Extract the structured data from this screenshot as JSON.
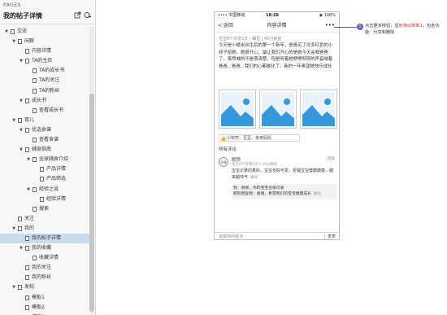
{
  "panel": {
    "label": "PAGES",
    "title": "我的帖子详情",
    "icons": [
      "export-icon",
      "add-page-icon"
    ]
  },
  "tree": [
    {
      "label": "交流",
      "depth": 0,
      "expanded": true
    },
    {
      "label": "闲聊",
      "depth": 1,
      "expanded": true
    },
    {
      "label": "内容详情",
      "depth": 2
    },
    {
      "label": "TA的主页",
      "depth": 2,
      "expanded": true
    },
    {
      "label": "TA的成长书",
      "depth": 3
    },
    {
      "label": "TA的关注",
      "depth": 3
    },
    {
      "label": "TA的粉丝",
      "depth": 3
    },
    {
      "label": "成长书",
      "depth": 2,
      "expanded": true
    },
    {
      "label": "查看成长书",
      "depth": 3
    },
    {
      "label": "育儿",
      "depth": 1,
      "expanded": true
    },
    {
      "label": "优选食谱",
      "depth": 2,
      "expanded": true
    },
    {
      "label": "查看食谱",
      "depth": 3
    },
    {
      "label": "辅食指南",
      "depth": 2,
      "expanded": true
    },
    {
      "label": "全球辅食介绍",
      "depth": 3,
      "expanded": true
    },
    {
      "label": "产品详情",
      "depth": 4
    },
    {
      "label": "产品筛选",
      "depth": 4
    },
    {
      "label": "经验之谈",
      "depth": 3,
      "expanded": true
    },
    {
      "label": "经验详情",
      "depth": 4
    },
    {
      "label": "搜索",
      "depth": 3
    },
    {
      "label": "关注",
      "depth": 1
    },
    {
      "label": "我的",
      "depth": 1,
      "expanded": true
    },
    {
      "label": "我的帖子详情",
      "depth": 2,
      "selected": true
    },
    {
      "label": "我的收藏",
      "depth": 2,
      "expanded": true
    },
    {
      "label": "收藏详情",
      "depth": 3
    },
    {
      "label": "我的关注",
      "depth": 2
    },
    {
      "label": "我的粉丝",
      "depth": 2
    },
    {
      "label": "发帖",
      "depth": 1,
      "expanded": true
    },
    {
      "label": "模板1",
      "depth": 2
    },
    {
      "label": "模板2",
      "depth": 2
    },
    {
      "label": "模板3",
      "depth": 2
    }
  ],
  "phone": {
    "status": {
      "carrier": "•••• 中国移动 ",
      "time": "18:28",
      "right": "◉ 100%"
    },
    "nav": {
      "back": "< 返回",
      "title": "内容详情",
      "more": "•••"
    },
    "post_meta": "宝宝8个月零2天 | 辅豆 | 45分钟前",
    "post_body": "今天是小橘米出生后的第一个新年，爸爸买了许多红色的小袄子给她。她很开心，最让我们开心的是她今天会喊爸爸了，虽然喊的不是很清楚，但是听着她咿咿呀呀的声音喊着爸爸...爸爸...我们的心都融化了。新的一年希望她快乐成长",
    "likes": "小突然、豆豆、亲亲妈妈",
    "all_comments": "所有评论",
    "comment": {
      "avatar": "头像",
      "name": "昵称",
      "meta": "宝宝8个月零2天 | 30分钟前",
      "reply_btn": "回复",
      "text": "宝宝记录的真好，宝宝也好可爱，祝福宝宝健康康康，越来越帅气",
      "delete": "删除",
      "sub1": "我：谢谢，你的宝宝也很可爱",
      "sub2": "昵称回复我：谢谢，希望我们的宝宝健康成长",
      "sub_delete": "删除"
    },
    "input_placeholder": "说说你的看法",
    "send": "发表"
  },
  "annotation": {
    "number": "1",
    "text_before": "点击更多按钮，显示",
    "text_highlight": "弹出菜单1",
    "text_after": "，包含功能：分享和删除"
  },
  "colors": {
    "selected_row": "#c9dcec",
    "annotation": "#6d5db5",
    "image_blue": "#3498db",
    "highlight": "#d13b3b"
  }
}
